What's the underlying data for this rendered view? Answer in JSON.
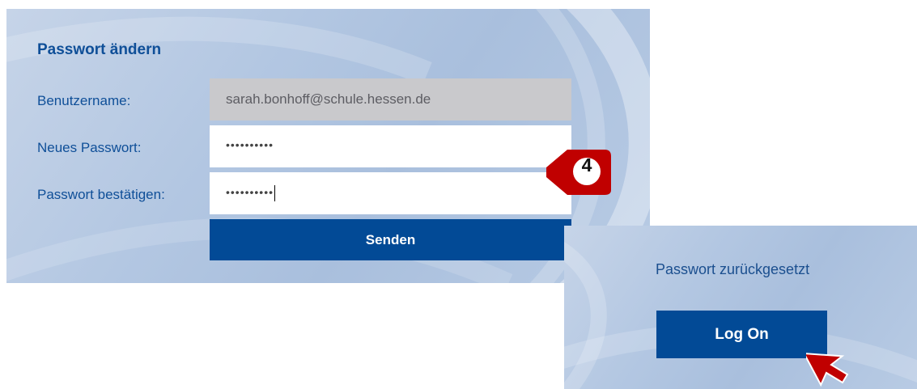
{
  "change_password": {
    "title": "Passwort ändern",
    "username_label": "Benutzername:",
    "username_value": "sarah.bonhoff@schule.hessen.de",
    "new_password_label": "Neues Passwort:",
    "new_password_value": "••••••••••",
    "confirm_password_label": "Passwort bestätigen:",
    "confirm_password_value": "••••••••••",
    "submit_label": "Senden"
  },
  "step_badge": {
    "number": "4",
    "color": "#c00000"
  },
  "reset_confirmation": {
    "status_text": "Passwort zurückgesetzt",
    "logon_label": "Log On"
  },
  "colors": {
    "accent": "#024a96",
    "label_text": "#0f4f98",
    "disabled_field": "#c9c9cc",
    "pointer": "#c00000"
  },
  "icons": {
    "pointer": "cursor-arrow-icon"
  }
}
